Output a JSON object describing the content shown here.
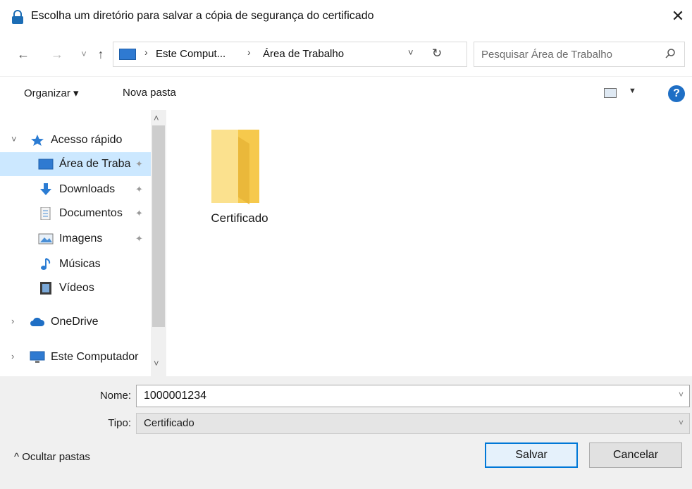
{
  "dialog": {
    "title": "Escolha um diretório para salvar a cópia de segurança do certificado",
    "close_glyph": "✕"
  },
  "nav_buttons": {
    "back": "←",
    "forward": "→",
    "recent": "˅",
    "up": "↑"
  },
  "address": {
    "crumbs": [
      "Este Comput...",
      "Área de Trabalho"
    ],
    "separator": "›",
    "dropdown_glyph": "˅",
    "refresh_glyph": "↻"
  },
  "search": {
    "placeholder": "Pesquisar Área de Trabalho"
  },
  "toolbar": {
    "organize_label": "Organizar ▾",
    "new_folder_label": "Nova pasta",
    "help_glyph": "?"
  },
  "sidebar": {
    "items": [
      {
        "label": "Acesso rápido",
        "icon": "star-icon",
        "chevron": "˅",
        "pinned": false,
        "selected": false
      },
      {
        "label": "Área de Traba",
        "icon": "desktop-icon",
        "chevron": "",
        "pinned": true,
        "selected": true
      },
      {
        "label": "Downloads",
        "icon": "download-icon",
        "chevron": "",
        "pinned": true,
        "selected": false
      },
      {
        "label": "Documentos",
        "icon": "document-icon",
        "chevron": "",
        "pinned": true,
        "selected": false
      },
      {
        "label": "Imagens",
        "icon": "image-icon",
        "chevron": "",
        "pinned": true,
        "selected": false
      },
      {
        "label": "Músicas",
        "icon": "music-icon",
        "chevron": "",
        "pinned": false,
        "selected": false
      },
      {
        "label": "Vídeos",
        "icon": "video-icon",
        "chevron": "",
        "pinned": false,
        "selected": false
      },
      {
        "label": "OneDrive",
        "icon": "cloud-icon",
        "chevron": "›",
        "pinned": false,
        "selected": false
      },
      {
        "label": "Este Computador",
        "icon": "computer-icon",
        "chevron": "›",
        "pinned": false,
        "selected": false
      }
    ],
    "pin_glyph": "✦"
  },
  "files": [
    {
      "name": "Certificado",
      "type": "folder"
    }
  ],
  "footer": {
    "name_label": "Nome:",
    "name_value": "1000001234",
    "type_label": "Tipo:",
    "type_value": "Certificado",
    "dropdown_glyph": "˅",
    "hide_folders_label": "^  Ocultar pastas",
    "save_label": "Salvar",
    "cancel_label": "Cancelar"
  },
  "colors": {
    "accent": "#0078d7",
    "selection": "#cce8ff",
    "folder": "#f8d775"
  }
}
